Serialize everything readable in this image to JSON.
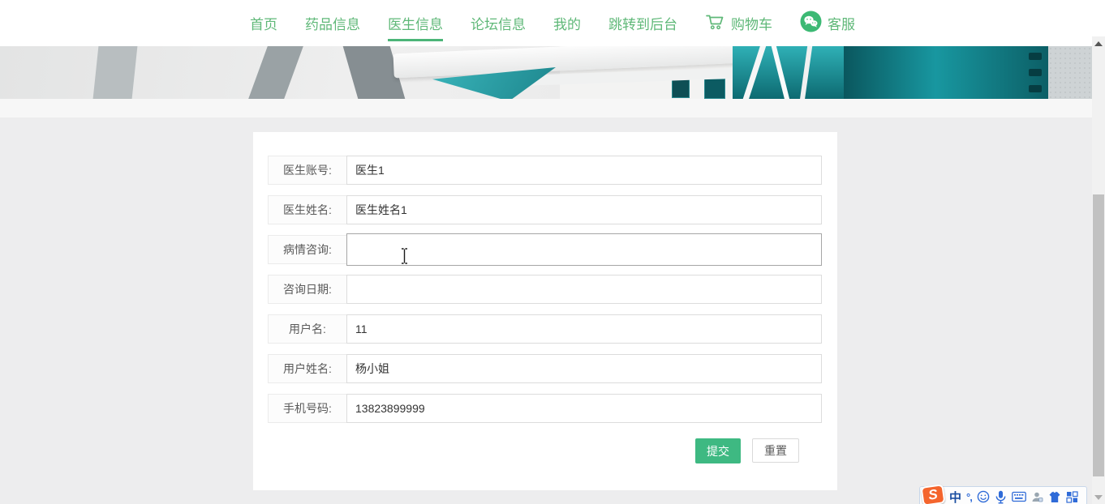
{
  "nav": {
    "items": [
      {
        "label": "首页",
        "active": false
      },
      {
        "label": "药品信息",
        "active": false
      },
      {
        "label": "医生信息",
        "active": true
      },
      {
        "label": "论坛信息",
        "active": false
      },
      {
        "label": "我的",
        "active": false
      },
      {
        "label": "跳转到后台",
        "active": false
      }
    ],
    "cart": {
      "label": "购物车"
    },
    "service": {
      "label": "客服"
    }
  },
  "form": {
    "rows": [
      {
        "label": "医生账号:",
        "value": "医生1"
      },
      {
        "label": "医生姓名:",
        "value": "医生姓名1"
      },
      {
        "label": "病情咨询:",
        "value": "",
        "focused": true
      },
      {
        "label": "咨询日期:",
        "value": ""
      },
      {
        "label": "用户名:",
        "value": "11"
      },
      {
        "label": "用户姓名:",
        "value": "杨小姐"
      },
      {
        "label": "手机号码:",
        "value": "13823899999"
      }
    ],
    "buttons": {
      "submit": "提交",
      "reset": "重置"
    }
  },
  "ime_toolbar": {
    "chinese_mode_label": "中",
    "punctuation_label": "°,",
    "icons": [
      "sogou-logo",
      "chinese-mode",
      "punctuation",
      "emoji-picker",
      "voice-input",
      "soft-keyboard",
      "account",
      "skin",
      "toolbox"
    ]
  },
  "colors": {
    "nav_green": "#5fb878",
    "button_green": "#3eb982",
    "hero_teal": "#1897a0",
    "hero_teal_dark": "#0d6a71"
  }
}
